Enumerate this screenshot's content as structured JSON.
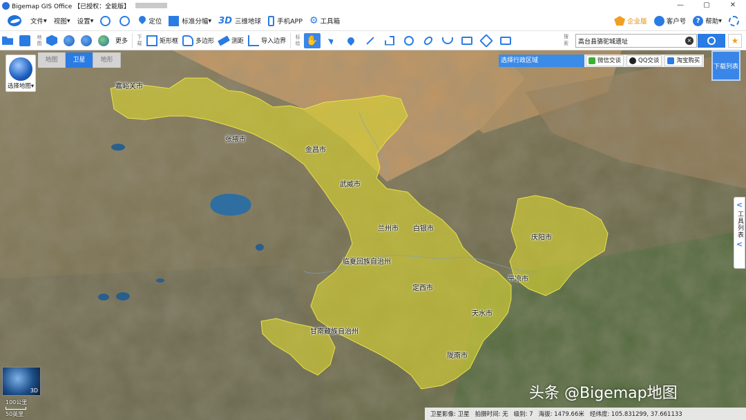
{
  "window": {
    "title": "Bigemap GIS Office 【已授权：全能版】",
    "controls": [
      "—",
      "▢",
      "✕"
    ]
  },
  "menu": {
    "items": [
      {
        "label": "文件",
        "has_dropdown": true
      },
      {
        "label": "视图",
        "has_dropdown": true
      },
      {
        "label": "设置",
        "has_dropdown": true
      }
    ],
    "tools": {
      "locate": "定位",
      "standard_tile": "标准分幅",
      "three_d": "三维地球",
      "three_d_glyph": "3D",
      "mobile": "手机APP",
      "toolbox": "工具箱"
    },
    "right": {
      "enterprise": "企业版",
      "customer": "客户号",
      "help": "帮助"
    }
  },
  "toolbar": {
    "map_group_label": "地图",
    "more": "更多",
    "download_group_label": "下载",
    "rect_frame": "矩形框",
    "polygon": "多边形",
    "measure": "测距",
    "import_boundary": "导入边界",
    "annotate_group_label": "标绘",
    "search_group_label": "搜索",
    "search_value": "高台县骆驼城遗址",
    "search_clear": "×",
    "fav_glyph": "★"
  },
  "map": {
    "choose_map": "选择地图",
    "tabs": [
      {
        "label": "地图",
        "active": false
      },
      {
        "label": "卫星",
        "active": true
      },
      {
        "label": "地形",
        "active": false
      }
    ],
    "region_select": "选择行政区域",
    "share": {
      "wechat": "微信交谈",
      "qq": "QQ交谈",
      "taobao": "淘宝购买"
    },
    "download_list": "下载列表",
    "tool_list": "工具列表",
    "tool_arrow": "<",
    "mini_globe_label": "3D",
    "scale": {
      "km": "100公里",
      "mi": "50英里"
    },
    "cities": [
      {
        "name": "嘉峪关市",
        "id": "jiayuguan"
      },
      {
        "name": "张掖市",
        "id": "zhangye"
      },
      {
        "name": "金昌市",
        "id": "jinchang"
      },
      {
        "name": "武威市",
        "id": "wuwei"
      },
      {
        "name": "兰州市",
        "id": "lanzhou"
      },
      {
        "name": "白银市",
        "id": "baiyin"
      },
      {
        "name": "临夏回族自治州",
        "id": "linxia"
      },
      {
        "name": "庆阳市",
        "id": "qingyang"
      },
      {
        "name": "平凉市",
        "id": "pingliang"
      },
      {
        "name": "定西市",
        "id": "dingxi"
      },
      {
        "name": "天水市",
        "id": "tianshui"
      },
      {
        "name": "甘南藏族自治州",
        "id": "gannan"
      },
      {
        "name": "陇南市",
        "id": "longnan"
      }
    ]
  },
  "status": {
    "imagery": "卫星影像: 卫星",
    "capture_time": "拍摄时间: 无",
    "level": "级别: 7",
    "elevation": "海拔: 1479.66米",
    "coords": "经纬度: 105.831299, 37.661133"
  },
  "watermark": "头条 @Bigemap地图",
  "colors": {
    "accent": "#2a7be4",
    "highlight": "#d4d236",
    "enterprise": "#e08b00"
  }
}
